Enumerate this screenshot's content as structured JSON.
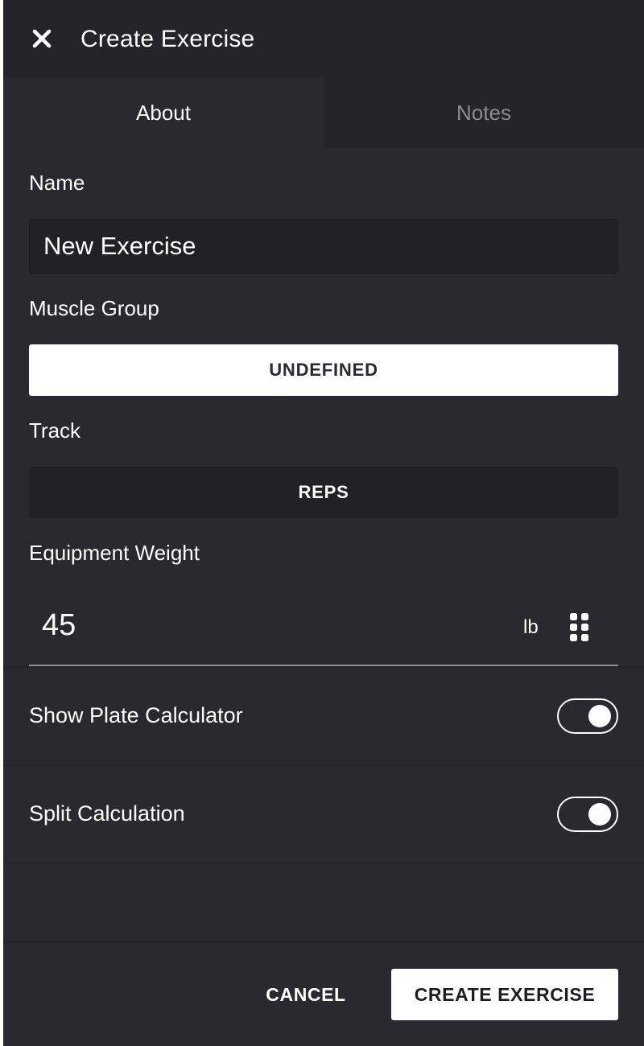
{
  "header": {
    "title": "Create Exercise",
    "close_icon": "close-icon"
  },
  "tabs": [
    {
      "label": "About",
      "active": true
    },
    {
      "label": "Notes",
      "active": false
    }
  ],
  "form": {
    "name_label": "Name",
    "name_value": "New Exercise",
    "muscle_group_label": "Muscle Group",
    "muscle_group_value": "UNDEFINED",
    "track_label": "Track",
    "track_value": "REPS",
    "equipment_weight_label": "Equipment Weight",
    "equipment_weight_value": "45",
    "equipment_weight_unit": "lb",
    "keypad_icon": "keypad-icon"
  },
  "toggles": [
    {
      "label": "Show Plate Calculator",
      "on": true
    },
    {
      "label": "Split Calculation",
      "on": true
    }
  ],
  "footer": {
    "cancel_label": "CANCEL",
    "create_label": "CREATE EXERCISE"
  },
  "colors": {
    "background": "#282a2f",
    "header_background": "#23252a",
    "primary_button": "#ffffff",
    "inactive_tab_text": "#8a8c91"
  }
}
